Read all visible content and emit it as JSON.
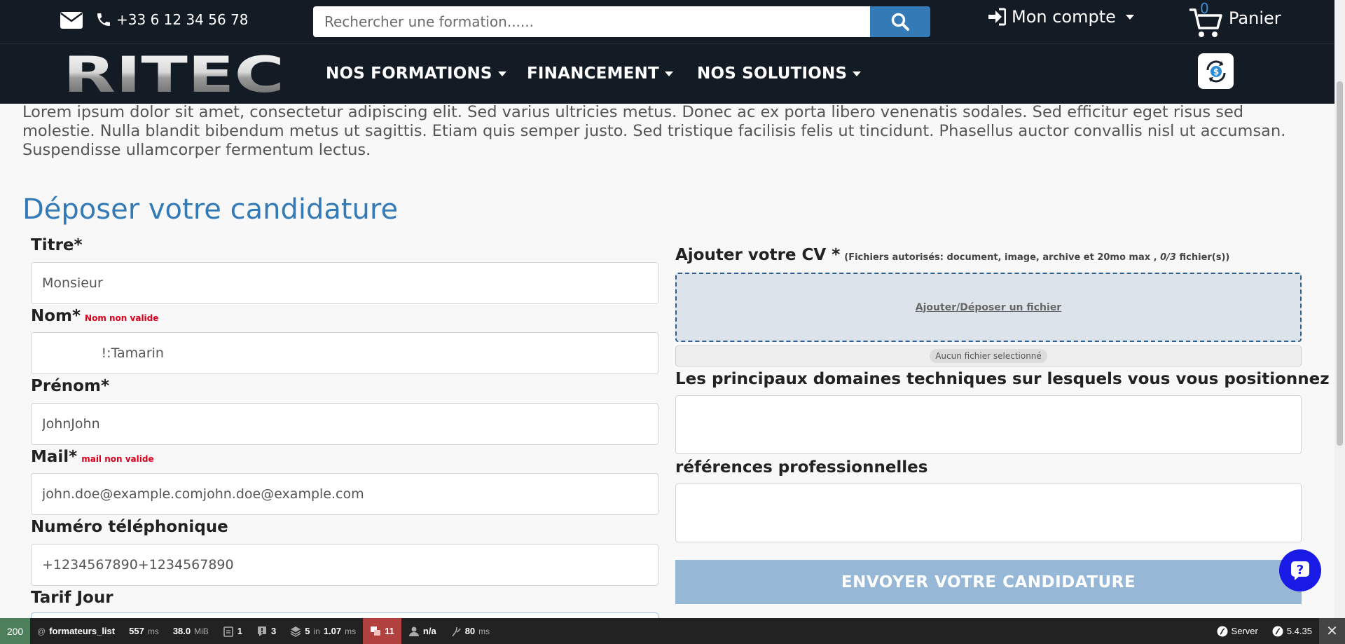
{
  "header": {
    "phone": "+33 6 12 34 56 78",
    "search_placeholder": "Rechercher une formation......",
    "account_label": "Mon compte",
    "cart_count": "0",
    "cart_label": "Panier",
    "logo_text": "RITEC"
  },
  "nav": {
    "formations": "NOS FORMATIONS",
    "financement": "FINANCEMENT",
    "solutions": "NOS SOLUTIONS"
  },
  "intro": {
    "text": "Lorem ipsum dolor sit amet, consectetur adipiscing elit. Sed varius ultricies metus. Donec ac ex porta libero venenatis sodales. Sed efficitur eget risus sed molestie. Nulla blandit bibendum metus ut sagittis. Etiam quis semper justo. Sed tristique facilisis felis ut tincidunt. Phasellus auctor convallis nisl ut accumsan. Suspendisse ullamcorper fermentum lectus."
  },
  "form": {
    "title": "Déposer votre candidature",
    "titre_label": "Titre*",
    "titre_value": "Monsieur",
    "nom_label": "Nom*",
    "nom_error": "Nom non valide",
    "nom_value": "              !:Tamarin",
    "prenom_label": "Prénom*",
    "prenom_value": "JohnJohn",
    "mail_label": "Mail*",
    "mail_error": "mail non valide",
    "mail_value": "john.doe@example.comjohn.doe@example.com",
    "tel_label": "Numéro téléphonique",
    "tel_value": "+1234567890+1234567890",
    "tarif_label": "Tarif Jour",
    "cv_label": "Ajouter votre CV *",
    "cv_hint_prefix": "(Fichiers autorisés: document, image, archive et 20mo max ,",
    "cv_hint_count": "0/3",
    "cv_hint_suffix": "fichier(s))",
    "dropzone_text": "Ajouter/Déposer un fichier",
    "no_file_text": "Aucun fichier selectionné",
    "domaines_label": "Les principaux domaines techniques sur lesquels vous vous positionnez",
    "references_label": "références professionnelles",
    "submit_label": "ENVOYER VOTRE CANDIDATURE"
  },
  "debug": {
    "status": "200",
    "route_prefix": "@",
    "route": "formateurs_list",
    "time": "557",
    "time_unit": "ms",
    "memory": "38.0",
    "memory_unit": "MiB",
    "forms": "1",
    "logs": "3",
    "cache": "5",
    "cache_in": "in",
    "cache_time": "1.07",
    "cache_unit": "ms",
    "translations": "11",
    "user": "n/a",
    "twig": "80",
    "twig_unit": "ms",
    "server": "Server",
    "version": "5.4.35"
  },
  "colors": {
    "header_bg": "#131b24",
    "accent": "#337ab7",
    "error": "#d9001b",
    "submit_disabled": "#96b7d6",
    "help": "#1a1ae6"
  }
}
